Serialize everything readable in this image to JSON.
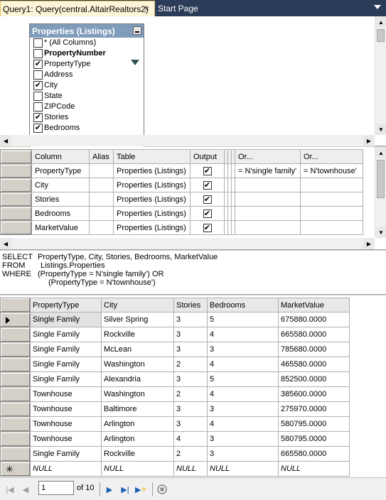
{
  "tabs": {
    "active_label": "Query1: Query(central.AltairRealtors2)",
    "close_glyph": "×",
    "inactive_label": "Start Page"
  },
  "diagram": {
    "table_title": "Properties (Listings)",
    "columns": [
      {
        "label": "* (All Columns)",
        "checked": false,
        "bold": false,
        "filter": false
      },
      {
        "label": "PropertyNumber",
        "checked": false,
        "bold": true,
        "filter": false
      },
      {
        "label": "PropertyType",
        "checked": true,
        "bold": false,
        "filter": true
      },
      {
        "label": "Address",
        "checked": false,
        "bold": false,
        "filter": false
      },
      {
        "label": "City",
        "checked": true,
        "bold": false,
        "filter": false
      },
      {
        "label": "State",
        "checked": false,
        "bold": false,
        "filter": false
      },
      {
        "label": "ZIPCode",
        "checked": false,
        "bold": false,
        "filter": false
      },
      {
        "label": "Stories",
        "checked": true,
        "bold": false,
        "filter": false
      },
      {
        "label": "Bedrooms",
        "checked": true,
        "bold": false,
        "filter": false
      }
    ]
  },
  "criteria": {
    "headers": {
      "column": "Column",
      "alias": "Alias",
      "table": "Table",
      "output": "Output",
      "or1": "Or...",
      "or2": "Or..."
    },
    "rows": [
      {
        "column": "PropertyType",
        "alias": "",
        "table": "Properties (Listings)",
        "output": true,
        "or1": "= N'single family'",
        "or2": "= N'townhouse'"
      },
      {
        "column": "City",
        "alias": "",
        "table": "Properties (Listings)",
        "output": true,
        "or1": "",
        "or2": ""
      },
      {
        "column": "Stories",
        "alias": "",
        "table": "Properties (Listings)",
        "output": true,
        "or1": "",
        "or2": ""
      },
      {
        "column": "Bedrooms",
        "alias": "",
        "table": "Properties (Listings)",
        "output": true,
        "or1": "",
        "or2": ""
      },
      {
        "column": "MarketValue",
        "alias": "",
        "table": "Properties (Listings)",
        "output": true,
        "or1": "",
        "or2": ""
      }
    ]
  },
  "sql": {
    "select_kw": "SELECT",
    "select_text": "PropertyType, City, Stories, Bedrooms, MarketValue",
    "from_kw": "FROM",
    "from_text": "Listings.Properties",
    "where_kw": "WHERE",
    "where_text": "(PropertyType = N'single family') OR",
    "where_text2": "(PropertyType = N'townhouse')"
  },
  "results": {
    "headers": [
      "PropertyType",
      "City",
      "Stories",
      "Bedrooms",
      "MarketValue"
    ],
    "rows": [
      [
        "Single Family",
        "Silver Spring",
        "3",
        "5",
        "675880.0000"
      ],
      [
        "Single Family",
        "Rockville",
        "3",
        "4",
        "665580.0000"
      ],
      [
        "Single Family",
        "McLean",
        "3",
        "3",
        "785680.0000"
      ],
      [
        "Single Family",
        "Washington",
        "2",
        "4",
        "465580.0000"
      ],
      [
        "Single Family",
        "Alexandria",
        "3",
        "5",
        "852500.0000"
      ],
      [
        "Townhouse",
        "Washington",
        "2",
        "4",
        "385600.0000"
      ],
      [
        "Townhouse",
        "Baltimore",
        "3",
        "3",
        "275970.0000"
      ],
      [
        "Townhouse",
        "Arlington",
        "3",
        "4",
        "580795.0000"
      ],
      [
        "Townhouse",
        "Arlington",
        "4",
        "3",
        "580795.0000"
      ],
      [
        "Single Family",
        "Rockville",
        "2",
        "3",
        "665580.0000"
      ]
    ],
    "new_row": [
      "NULL",
      "NULL",
      "NULL",
      "NULL",
      "NULL"
    ],
    "new_row_marker": "✳"
  },
  "navigator": {
    "current_page": "1",
    "of_label": "of 10"
  },
  "colors": {
    "tab_bar": "#2b3c59",
    "tab_active": "#fcf5d8",
    "table_header": "#7f9dbb"
  }
}
